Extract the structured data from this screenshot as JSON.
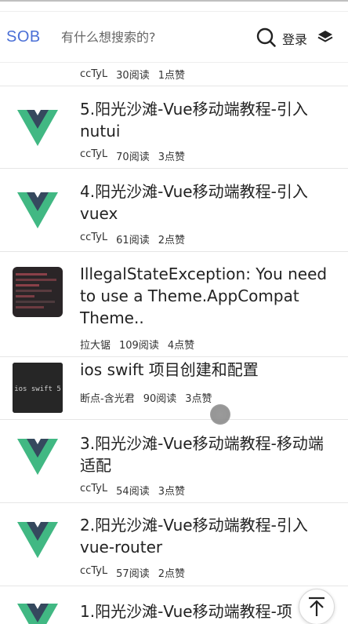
{
  "header": {
    "logo": "SOB",
    "search_placeholder": "有什么想搜索的?",
    "login_label": "登录",
    "icons": {
      "search": "search-icon",
      "menu": "layers-icon"
    }
  },
  "partial_item": {
    "author": "ccTyL",
    "reads": "30阅读",
    "likes": "1点赞"
  },
  "articles": [
    {
      "title": "5.阳光沙滩-Vue移动端教程-引入nutui",
      "author": "ccTyL",
      "reads": "70阅读",
      "likes": "3点赞",
      "thumb": "vue-logo"
    },
    {
      "title": "4.阳光沙滩-Vue移动端教程-引入vuex",
      "author": "ccTyL",
      "reads": "61阅读",
      "likes": "2点赞",
      "thumb": "vue-logo"
    },
    {
      "title": "IllegalStateException: You need to use a Theme.AppCompat Theme..",
      "author": "拉大锯",
      "reads": "109阅读",
      "likes": "4点赞",
      "thumb": "code-screenshot"
    },
    {
      "title": "ios swift 项目创建和配置",
      "author": "断点-含光君",
      "reads": "90阅读",
      "likes": "3点赞",
      "thumb": "ios swift 5"
    },
    {
      "title": "3.阳光沙滩-Vue移动端教程-移动端适配",
      "author": "ccTyL",
      "reads": "54阅读",
      "likes": "3点赞",
      "thumb": "vue-logo"
    },
    {
      "title": "2.阳光沙滩-Vue移动端教程-引入vue-router",
      "author": "ccTyL",
      "reads": "57阅读",
      "likes": "2点赞",
      "thumb": "vue-logo"
    },
    {
      "title": "1.阳光沙滩-Vue移动端教程-项",
      "thumb": "vue-logo"
    }
  ],
  "colors": {
    "brand": "#4a6fd6",
    "vue_green": "#41b883",
    "vue_dark": "#35495e"
  },
  "back_to_top_icon": "arrow-up-icon"
}
